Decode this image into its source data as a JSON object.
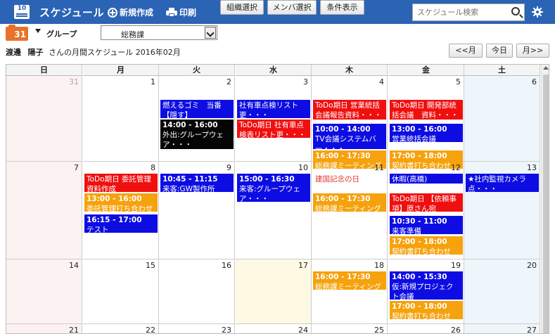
{
  "header": {
    "icon_day": "10",
    "title": "スケジュール",
    "new_label": "新規作成",
    "print_label": "印刷",
    "search_placeholder": "スケジュール検索"
  },
  "toolbar": {
    "group_icon_day": "31",
    "group_label": "グループ",
    "department": "総務課",
    "org_select": "組織選択",
    "member_select": "メンバ選択",
    "condition_show": "条件表示"
  },
  "owner": {
    "last_name": "渡邊",
    "first_name": "陽子",
    "suffix": "さんの月間スケジュール 2016年02月"
  },
  "nav": {
    "prev": "<<月",
    "today": "今日",
    "next": "月>>"
  },
  "colors": {
    "red": "#f00f0f",
    "blue": "#0d0de3",
    "black": "#050505",
    "orange": "#f6a20d",
    "header": "#2b63b5"
  },
  "weekdays": [
    "日",
    "月",
    "火",
    "水",
    "木",
    "金",
    "土"
  ],
  "weeks": [
    {
      "days": [
        {
          "num": "31",
          "prev": true,
          "events": []
        },
        {
          "num": "1",
          "events": []
        },
        {
          "num": "2",
          "events": [
            {
              "color": "blue",
              "time": "",
              "text": "燃えるゴミ　当番【隠す】"
            },
            {
              "color": "black",
              "time": "14:00 - 16:00",
              "text": "外出:グループウェア・・・"
            }
          ]
        },
        {
          "num": "3",
          "events": [
            {
              "color": "blue",
              "time": "",
              "text": "社有車点検リスト更・・・"
            },
            {
              "color": "red",
              "time": "",
              "text": "ToDo期日 社有車点検表リスト更・・・"
            }
          ]
        },
        {
          "num": "4",
          "events": [
            {
              "color": "red",
              "time": "",
              "text": "ToDo期日 営業統括会議報告資料・・・"
            },
            {
              "color": "blue",
              "time": "10:00 - 14:00",
              "text": "TV会議システムバー・・・"
            },
            {
              "color": "orange",
              "time": "16:00 - 17:30",
              "text": "総務課ミーティング"
            }
          ]
        },
        {
          "num": "5",
          "events": [
            {
              "color": "red",
              "time": "",
              "text": "ToDo期日 開発部統括会議　資料・・・"
            },
            {
              "color": "blue",
              "time": "13:00 - 16:00",
              "text": "営業統括会議"
            },
            {
              "color": "orange",
              "time": "17:00 - 18:00",
              "text": "契約書打ち合わせ"
            }
          ]
        },
        {
          "num": "6",
          "events": []
        }
      ]
    },
    {
      "days": [
        {
          "num": "7",
          "events": []
        },
        {
          "num": "8",
          "events": [
            {
              "color": "red",
              "time": "",
              "text": "ToDo期日 委託管理資料作成"
            },
            {
              "color": "orange",
              "time": "13:00 - 16:00",
              "text": "委託管理打ち合わせ"
            },
            {
              "color": "blue",
              "time": "16:15 - 17:00",
              "text": "テスト"
            }
          ]
        },
        {
          "num": "9",
          "events": [
            {
              "color": "blue",
              "time": "10:45 - 11:15",
              "text": "来客:GW製作所"
            }
          ]
        },
        {
          "num": "10",
          "events": [
            {
              "color": "blue",
              "time": "15:00 - 16:30",
              "text": "来客:グループウェア・・・"
            }
          ]
        },
        {
          "num": "11",
          "events": [
            {
              "color": "plain",
              "time": "",
              "text": "建国記念の日"
            },
            {
              "color": "orange",
              "time": "16:00 - 17:30",
              "text": "総務課ミーティング"
            }
          ]
        },
        {
          "num": "12",
          "events": [
            {
              "color": "blue",
              "time": "",
              "text": "休暇(高橋)"
            },
            {
              "color": "red",
              "time": "",
              "text": "ToDo期日 【依頼事項】原さん宛"
            },
            {
              "color": "blue",
              "time": "10:30 - 11:00",
              "text": "来客準備"
            },
            {
              "color": "orange",
              "time": "17:00 - 18:00",
              "text": "契約書打ち合わせ"
            }
          ]
        },
        {
          "num": "13",
          "events": [
            {
              "color": "blue",
              "time": "",
              "text": "★社内監視カメラ点・・・"
            }
          ]
        }
      ]
    },
    {
      "days": [
        {
          "num": "14",
          "events": []
        },
        {
          "num": "15",
          "events": []
        },
        {
          "num": "16",
          "events": []
        },
        {
          "num": "17",
          "today": true,
          "events": []
        },
        {
          "num": "18",
          "events": [
            {
              "color": "orange",
              "time": "16:00 - 17:30",
              "text": "総務課ミーティング"
            }
          ]
        },
        {
          "num": "19",
          "events": [
            {
              "color": "blue",
              "time": "14:00 - 15:30",
              "text": "仮:新規プロジェクト会議"
            },
            {
              "color": "orange",
              "time": "17:00 - 18:00",
              "text": "契約書打ち合わせ"
            }
          ]
        },
        {
          "num": "20",
          "events": []
        }
      ]
    },
    {
      "days": [
        {
          "num": "21",
          "events": []
        },
        {
          "num": "22",
          "events": []
        },
        {
          "num": "23",
          "events": []
        },
        {
          "num": "24",
          "events": []
        },
        {
          "num": "25",
          "events": []
        },
        {
          "num": "26",
          "events": []
        },
        {
          "num": "27",
          "events": []
        }
      ]
    }
  ]
}
